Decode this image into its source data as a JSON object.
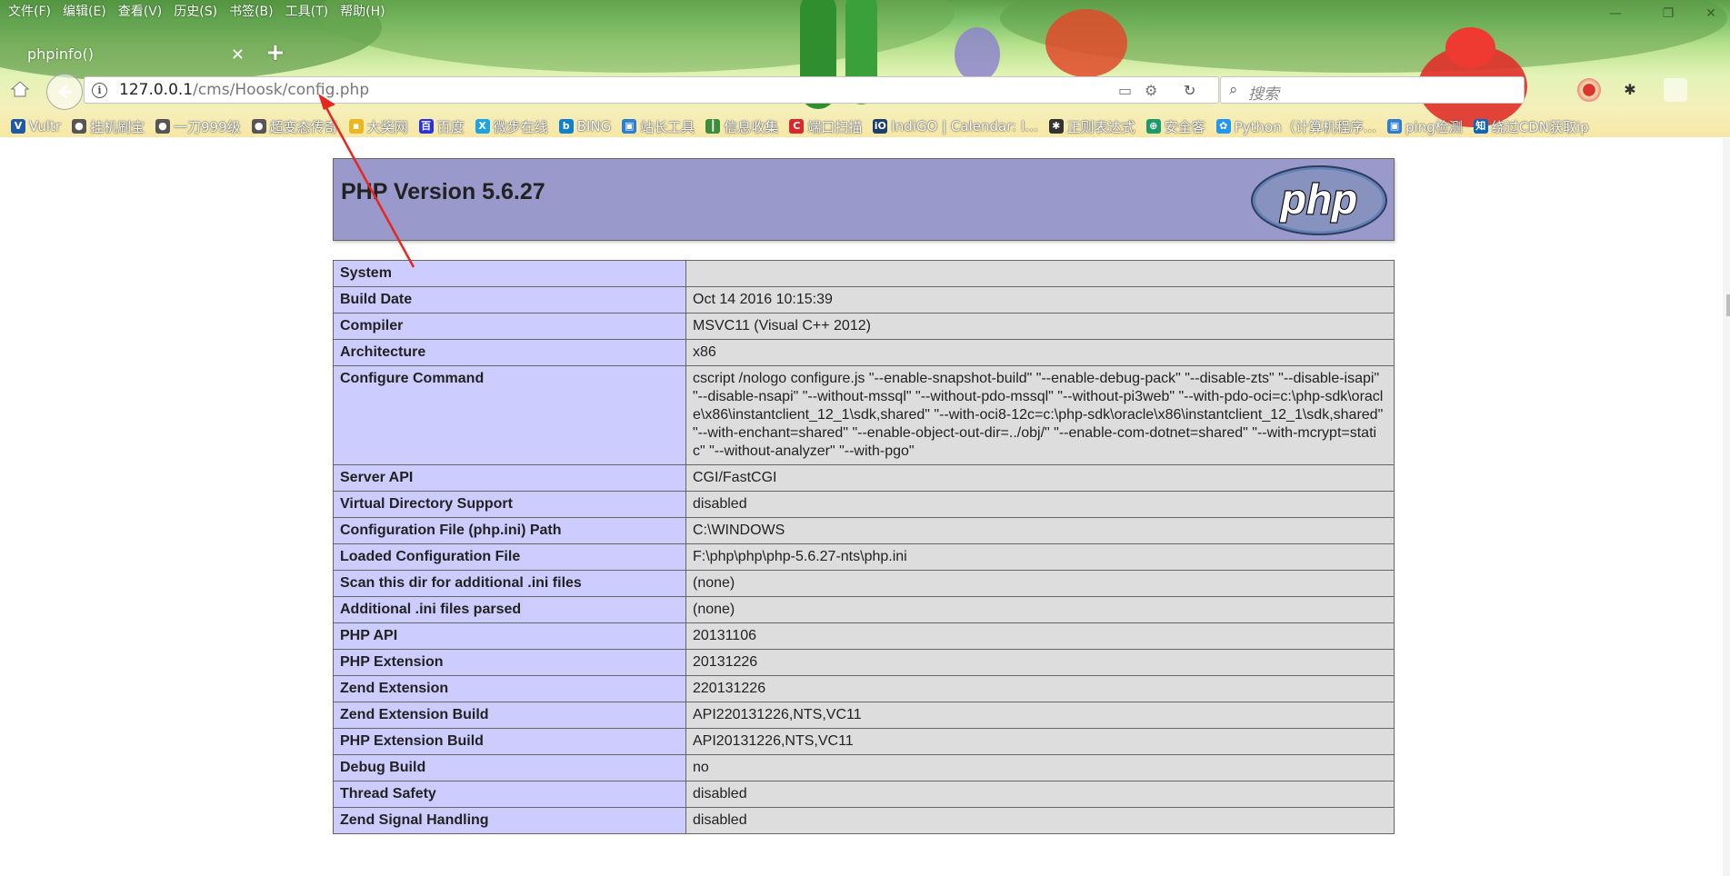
{
  "menu": [
    "文件(F)",
    "编辑(E)",
    "查看(V)",
    "历史(S)",
    "书签(B)",
    "工具(T)",
    "帮助(H)"
  ],
  "tab": {
    "title": "phpinfo()"
  },
  "address": {
    "host": "127.0.0.1",
    "path": "/cms/Hoosk/config.php"
  },
  "search": {
    "placeholder": "搜索"
  },
  "bookmarks": [
    {
      "label": "Vultr",
      "icon": "V",
      "color": "#1e5aa8"
    },
    {
      "label": "挂机刷宝",
      "icon": "●",
      "color": "#555555"
    },
    {
      "label": "一刀999级",
      "icon": "●",
      "color": "#555555"
    },
    {
      "label": "超变态传奇",
      "icon": "●",
      "color": "#555555"
    },
    {
      "label": "大奖网",
      "icon": "▪",
      "color": "#e8b820"
    },
    {
      "label": "百度",
      "icon": "百",
      "color": "#2932e1"
    },
    {
      "label": "微步在线",
      "icon": "X",
      "color": "#1aa3e8"
    },
    {
      "label": "BING",
      "icon": "b",
      "color": "#0f7fcf"
    },
    {
      "label": "站长工具",
      "icon": "▣",
      "color": "#2d7dd2"
    },
    {
      "label": "信息收集",
      "icon": "┃",
      "color": "#3c8d3c"
    },
    {
      "label": "端口扫描",
      "icon": "C",
      "color": "#d8272d"
    },
    {
      "label": "IndiGO | Calendar: I...",
      "icon": "iO",
      "color": "#1c3e6e"
    },
    {
      "label": "正则表达式",
      "icon": "✱",
      "color": "#333333"
    },
    {
      "label": "安全客",
      "icon": "⊕",
      "color": "#1d9a6c"
    },
    {
      "label": "Python（计算机程序...",
      "icon": "✿",
      "color": "#2196f3"
    },
    {
      "label": "ping检测",
      "icon": "▣",
      "color": "#2d7dd2"
    },
    {
      "label": "绕过CDN获取ip",
      "icon": "知",
      "color": "#0a66c2"
    }
  ],
  "php": {
    "version_title": "PHP Version 5.6.27",
    "logo_text": "php",
    "rows": [
      {
        "name": "System",
        "value": ""
      },
      {
        "name": "Build Date",
        "value": "Oct 14 2016 10:15:39"
      },
      {
        "name": "Compiler",
        "value": "MSVC11 (Visual C++ 2012)"
      },
      {
        "name": "Architecture",
        "value": "x86"
      },
      {
        "name": "Configure Command",
        "value": "cscript /nologo configure.js \"--enable-snapshot-build\" \"--enable-debug-pack\" \"--disable-zts\" \"--disable-isapi\" \"--disable-nsapi\" \"--without-mssql\" \"--without-pdo-mssql\" \"--without-pi3web\" \"--with-pdo-oci=c:\\php-sdk\\oracle\\x86\\instantclient_12_1\\sdk,shared\" \"--with-oci8-12c=c:\\php-sdk\\oracle\\x86\\instantclient_12_1\\sdk,shared\" \"--with-enchant=shared\" \"--enable-object-out-dir=../obj/\" \"--enable-com-dotnet=shared\" \"--with-mcrypt=static\" \"--without-analyzer\" \"--with-pgo\""
      },
      {
        "name": "Server API",
        "value": "CGI/FastCGI"
      },
      {
        "name": "Virtual Directory Support",
        "value": "disabled"
      },
      {
        "name": "Configuration File (php.ini) Path",
        "value": "C:\\WINDOWS"
      },
      {
        "name": "Loaded Configuration File",
        "value": "F:\\php\\php\\php-5.6.27-nts\\php.ini"
      },
      {
        "name": "Scan this dir for additional .ini files",
        "value": "(none)"
      },
      {
        "name": "Additional .ini files parsed",
        "value": "(none)"
      },
      {
        "name": "PHP API",
        "value": "20131106"
      },
      {
        "name": "PHP Extension",
        "value": "20131226"
      },
      {
        "name": "Zend Extension",
        "value": "220131226"
      },
      {
        "name": "Zend Extension Build",
        "value": "API220131226,NTS,VC11"
      },
      {
        "name": "PHP Extension Build",
        "value": "API20131226,NTS,VC11"
      },
      {
        "name": "Debug Build",
        "value": "no"
      },
      {
        "name": "Thread Safety",
        "value": "disabled"
      },
      {
        "name": "Zend Signal Handling",
        "value": "disabled"
      }
    ]
  }
}
